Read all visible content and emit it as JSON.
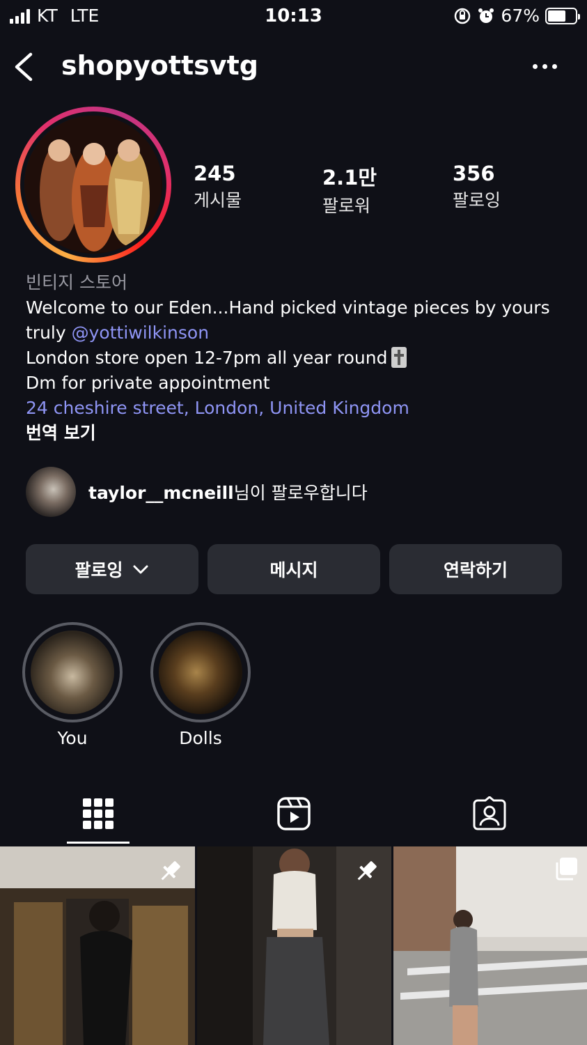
{
  "status_bar": {
    "carrier": "KT",
    "network": "LTE",
    "time": "10:13",
    "battery": "67%",
    "battery_level": 0.67
  },
  "header": {
    "username": "shopyottsvtg",
    "back_icon": "chevron-left-icon",
    "more_icon": "more-horizontal-icon"
  },
  "stats": [
    {
      "value": "245",
      "label": "게시물"
    },
    {
      "value": "2.1만",
      "label": "팔로워"
    },
    {
      "value": "356",
      "label": "팔로잉"
    }
  ],
  "bio": {
    "category": "빈티지 스토어",
    "line1": "Welcome to our Eden...Hand picked vintage pieces by yours",
    "line2_prefix": "truly ",
    "mention": "@yottiwilkinson",
    "line3": "London store open 12-7pm all year round",
    "line4": "Dm for private appointment",
    "address": "24 cheshire street, London, United Kingdom",
    "translate": "번역 보기"
  },
  "followed_by": {
    "name": "taylor__mcneill",
    "suffix": "님이 팔로우합니다"
  },
  "buttons": {
    "following": "팔로잉",
    "message": "메시지",
    "contact": "연락하기"
  },
  "highlights": [
    {
      "label": "You"
    },
    {
      "label": "Dolls"
    }
  ],
  "tabs": [
    {
      "icon": "grid-icon",
      "active": true
    },
    {
      "icon": "reels-icon",
      "active": false
    },
    {
      "icon": "tagged-icon",
      "active": false
    }
  ],
  "colors": {
    "background": "#0f1017",
    "button": "#2a2c33",
    "link": "#8f95f5",
    "muted": "#9a9aa3"
  }
}
